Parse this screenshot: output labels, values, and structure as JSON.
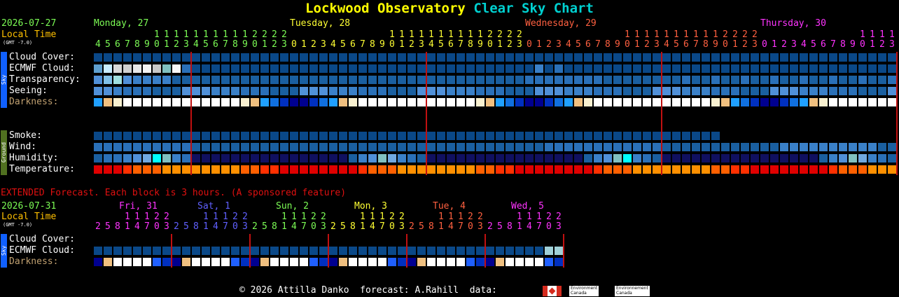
{
  "title": {
    "name": "Lockwood Observatory",
    "chart": "Clear Sky Chart"
  },
  "header": {
    "date": "2026-07-27",
    "local_time": "Local Time",
    "gmt": "(GMT -7.0)",
    "days": [
      {
        "label": "Monday, 27",
        "color": "#7cfc55"
      },
      {
        "label": "Tuesday, 28",
        "color": "#ffff33"
      },
      {
        "label": "Wednesday, 29",
        "color": "#ff6040"
      },
      {
        "label": "Thursday, 30",
        "color": "#ff33ff"
      }
    ],
    "tens_mon": "1111111112222",
    "ones_mon": "4567890123",
    "hours_full": "01234567890123456789012345678901234567890123456789012345678901234567890123456789012345678901234567890123",
    "tens_row": "111111111112222"
  },
  "sky_rows": [
    "Cloud Cover:",
    "ECMWF Cloud:",
    "Transparency:",
    "Seeing:",
    "Darkness:"
  ],
  "ground_rows": [
    "Smoke:",
    "Wind:",
    "Humidity:",
    "Temperature:"
  ],
  "sidebar": {
    "sky": "Sky",
    "ground": "Ground"
  },
  "extended": {
    "notice": "EXTENDED Forecast. Each block is 3 hours. (A sponsored feature)",
    "date": "2026-07-31",
    "local_time": "Local Time",
    "gmt": "(GMT -7.0)",
    "days": [
      {
        "label": "Fri, 31",
        "color": "#ff33ff"
      },
      {
        "label": "Sat, 1",
        "color": "#6060ff"
      },
      {
        "label": "Sun, 2",
        "color": "#7cfc55"
      },
      {
        "label": "Mon, 3",
        "color": "#ffff33"
      },
      {
        "label": "Tue, 4",
        "color": "#ff6040"
      },
      {
        "label": "Wed, 5",
        "color": "#ff33ff"
      }
    ],
    "tens": "11122",
    "hours": "25814703",
    "rows": [
      "Cloud Cover:",
      "ECMWF Cloud:",
      "Darkness:"
    ]
  },
  "footer": {
    "text": "© 2026 Attilla Danko  forecast: A.Rahill  data:",
    "env1": "Environment\nCanada",
    "env2": "Environnement\nCanada"
  },
  "colors": {
    "label": "#ffffff",
    "darkness_label": "#c0a070",
    "date": "#7cfc55",
    "local_time": "#ffc000",
    "title_name": "#ffff00",
    "title_chart": "#00d0d0",
    "cloud_clear": "#003f7f",
    "divider": "#c01010"
  }
}
